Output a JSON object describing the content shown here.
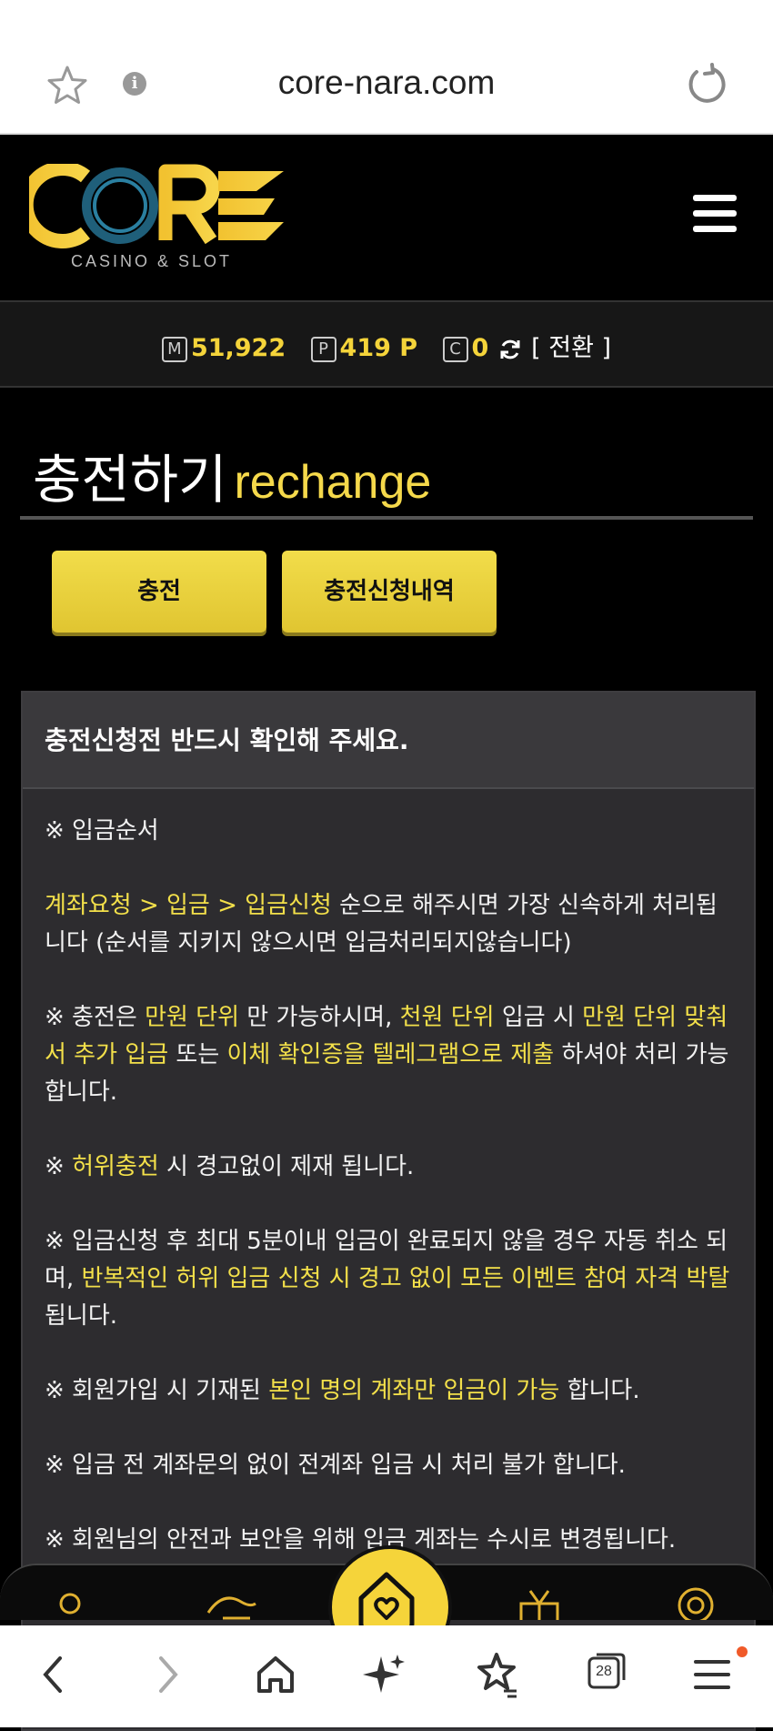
{
  "browser": {
    "url": "core-nara.com",
    "tab_count": "28"
  },
  "logo": {
    "name": "CORE",
    "tagline": "CASINO & SLOT"
  },
  "balance": {
    "money_badge": "M",
    "money": "51,922",
    "point_badge": "P",
    "point": "419 P",
    "coin_badge": "C",
    "coin": "0",
    "convert_label": "[ 전환 ]"
  },
  "page": {
    "title_ko": "충전하기",
    "title_en": "rechange"
  },
  "buttons": {
    "recharge": "충전",
    "history": "충전신청내역"
  },
  "notice": {
    "title": "충전신청전 반드시 확인해 주세요.",
    "order_heading": "※ 입금순서",
    "l1_hl": "계좌요청 > 입금 > 입금신청",
    "l1_rest": " 순으로 해주시면 가장 신속하게 처리됩니다 (순서를 지키지 않으시면 입금처리되지않습니다)",
    "l2_a": "※ 충전은 ",
    "l2_b": "만원 단위",
    "l2_c": " 만 가능하시며, ",
    "l2_d": "천원 단위",
    "l2_e": " 입금 시 ",
    "l2_f": "만원 단위 맞춰서 추가 입금",
    "l2_g": " 또는 ",
    "l2_h": "이체 확인증을 텔레그램으로 제출",
    "l2_i": " 하셔야 처리 가능합니다.",
    "l3_a": "※ ",
    "l3_b": "허위충전",
    "l3_c": " 시 경고없이 제재 됩니다.",
    "l4_a": "※ 입금신청 후 최대 5분이내 입금이 완료되지 않을 경우 자동 취소 되며, ",
    "l4_b": "반복적인 허위 입금 신청 시 경고 없이 모든 이벤트 참여 자격 박탈",
    "l4_c": " 됩니다.",
    "l5_a": "※ 회원가입 시 기재된 ",
    "l5_b": "본인 명의 계좌만 입금이 가능",
    "l5_c": " 합니다.",
    "l6": "※ 입금 전 계좌문의 없이 전계좌 입금 시 처리 불가 합니다.",
    "l7": "※ 회원님의 안전과 보안을 위해 입금 계좌는 수시로 변경됩니다."
  },
  "colors": {
    "accent": "#f5d43a",
    "highlight_text": "#f3e04a",
    "background": "#000000",
    "panel": "#2d2c2f"
  }
}
